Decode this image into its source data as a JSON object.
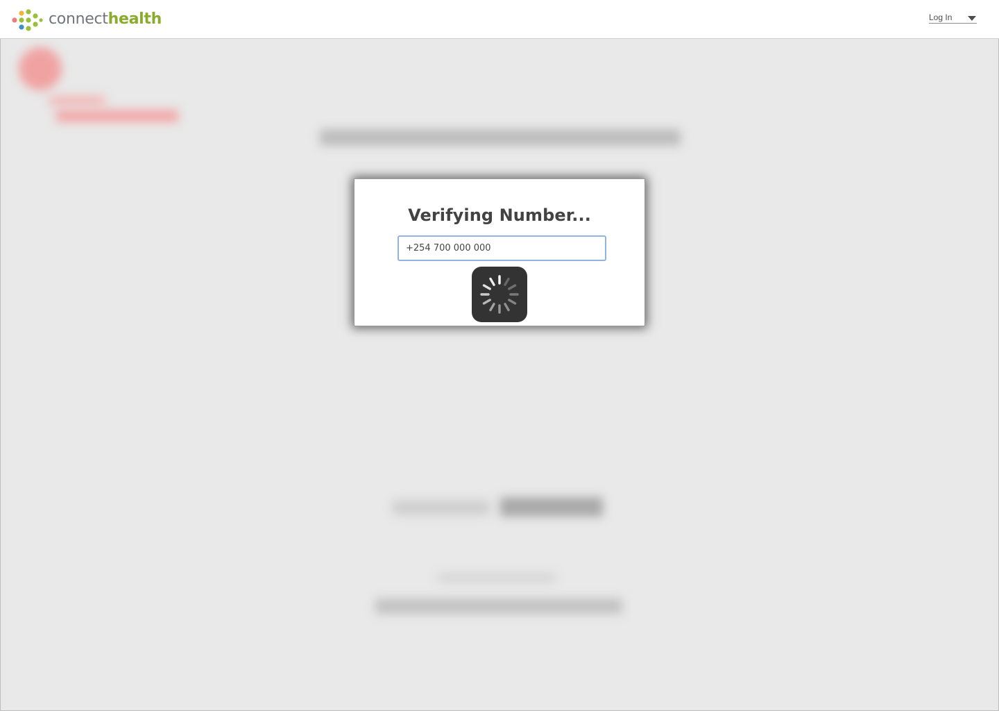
{
  "header": {
    "brand_connect": "connect",
    "brand_health": "health",
    "login_label": "Log In"
  },
  "icons": {
    "logo": "connecthealth-dots-logo-icon",
    "login_menu": "chevron-down-icon",
    "loading": "loading-spinner-icon"
  },
  "modal": {
    "title": "Verifying Number...",
    "phone_value": "+254 700 000 000"
  },
  "colors": {
    "brand_green": "#8aab2d",
    "brand_gray": "#6f767b",
    "overlay": "#e9e9e9",
    "input_focus_border": "#8fb3e6",
    "spinner_bg": "#333333"
  }
}
